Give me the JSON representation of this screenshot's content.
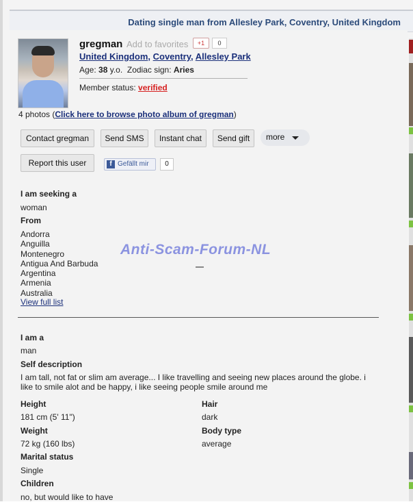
{
  "header": {
    "title": "Dating single man from Allesley Park, Coventry, United Kingdom"
  },
  "profile": {
    "username": "gregman",
    "add_favorites": "Add to favorites",
    "gplus_label": "+1",
    "gplus_count": "0",
    "country": "United Kingdom",
    "city": "Coventry",
    "area": "Allesley Park",
    "age_label": "Age:",
    "age": "38",
    "age_unit": "y.o.",
    "zodiac_label": "Zodiac sign:",
    "zodiac": "Aries",
    "status_label": "Member status:",
    "status": "verified",
    "photos_count": "4 photos (",
    "photos_link": "Click here to browse photo album of gregman",
    "photos_close": ")"
  },
  "actions": {
    "contact": "Contact gregman",
    "sms": "Send SMS",
    "chat": "Instant chat",
    "gift": "Send gift",
    "more": "more",
    "report": "Report this user",
    "fb_like": "Gefällt mir",
    "fb_count": "0"
  },
  "seeking": {
    "title": "I am seeking a",
    "value": "woman",
    "from_title": "From",
    "countries": [
      "Andorra",
      "Anguilla",
      "Montenegro",
      "Antigua And Barbuda",
      "Argentina",
      "Armenia",
      "Australia"
    ],
    "view_full": "View full list"
  },
  "about": {
    "iam_title": "I am a",
    "iam_value": "man",
    "self_title": "Self description",
    "self_text": "I am tall, not fat or slim am average... I like travelling and seeing new places around the globe. i like to smile alot and be happy, i like seeing people smile around me",
    "height_title": "Height",
    "height_value": "181 cm (5' 11\")",
    "hair_title": "Hair",
    "hair_value": "dark",
    "weight_title": "Weight",
    "weight_value": "72 kg (160 lbs)",
    "body_title": "Body type",
    "body_value": "average",
    "marital_title": "Marital status",
    "marital_value": "Single",
    "children_title": "Children",
    "children_value": "no, but would like to have"
  },
  "watermark": "Anti-Scam-Forum-NL",
  "colors": {
    "link": "#1a2f7a",
    "verified": "#d62020",
    "watermark": "#8b93e0"
  }
}
